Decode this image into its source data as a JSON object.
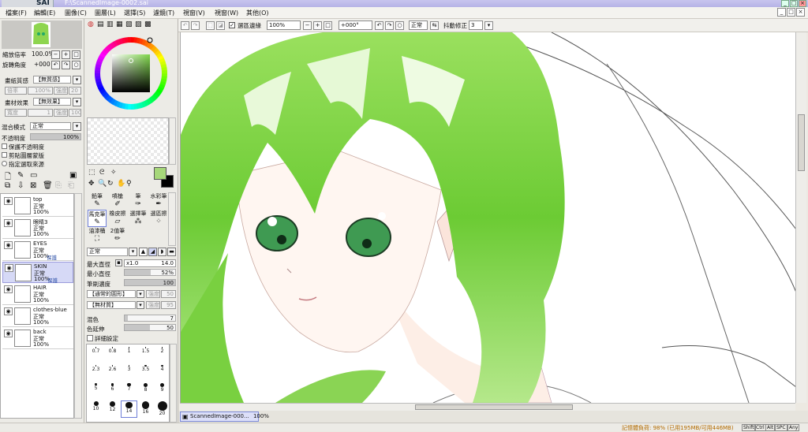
{
  "app": {
    "logo": "SAI",
    "title": "F:\\ScannedImage-0002.sai"
  },
  "window_buttons": [
    "_",
    "□",
    "×"
  ],
  "menu": [
    "檔案(F)",
    "編輯(E)",
    "圖像(C)",
    "圖層(L)",
    "選擇(S)",
    "濾鏡(T)",
    "視窗(V)",
    "視窗(W)",
    "其他(O)"
  ],
  "toolbar": {
    "selection_edge_label": "選區邊緣",
    "zoom_value": "100%",
    "rotation_value": "+000°",
    "blend_mode": "正常",
    "stabilizer_label": "抖動修正",
    "stabilizer_value": "3"
  },
  "navigator": {
    "zoom_label": "縮放倍率",
    "zoom_value": "100.0%",
    "rotate_label": "旋轉角度",
    "rotate_value": "+000"
  },
  "paper": {
    "texture_label": "畫紙質感",
    "texture_value": "【無質感】",
    "scale_label": "倍率",
    "scale_value": "100%",
    "strength_label": "強度",
    "strength_value": "20",
    "effect_label": "畫材效果",
    "effect_value": "【無效果】",
    "width_label": "寬度",
    "width_value": "1",
    "effect_strength_value": "100"
  },
  "layer_props": {
    "blend_label": "混合模式",
    "blend_value": "正常",
    "opacity_label": "不透明度",
    "opacity_value": "100%",
    "opacity_fraction": 1.0,
    "preserve_opacity": "保護不透明度",
    "clipping": "剪貼圖層蒙版",
    "selection_source": "指定選取來源"
  },
  "layers": [
    {
      "name": "top",
      "mode": "正常",
      "opacity": "100%",
      "protect": ""
    },
    {
      "name": "眼睛3",
      "mode": "正常",
      "opacity": "100%",
      "protect": ""
    },
    {
      "name": "EYES",
      "mode": "正常",
      "opacity": "100%",
      "protect": "保護"
    },
    {
      "name": "SKIN",
      "mode": "正常",
      "opacity": "100%",
      "protect": "保護"
    },
    {
      "name": "HAIR",
      "mode": "正常",
      "opacity": "100%",
      "protect": ""
    },
    {
      "name": "clothes-blue",
      "mode": "正常",
      "opacity": "100%",
      "protect": ""
    },
    {
      "name": "back",
      "mode": "正常",
      "opacity": "100%",
      "protect": ""
    }
  ],
  "tools_row1": [
    "鉛筆",
    "噴槍",
    "筆",
    "水彩筆"
  ],
  "tools_row2": [
    "馬克筆",
    "橡皮擦",
    "選擇筆",
    "選區擦"
  ],
  "tools_row3": [
    "油漆桶",
    "2值筆"
  ],
  "brush": {
    "mode_value": "正常",
    "max_size_label": "最大直徑",
    "max_size_mult": "x1.0",
    "max_size_value": "14.0",
    "min_size_label": "最小直徑",
    "min_size_value": "52%",
    "min_fraction": 0.52,
    "density_label": "筆刷濃度",
    "density_value": "100",
    "density_fraction": 1.0,
    "shape_value": "【通常的圓形】",
    "shape_strength_label": "強度",
    "shape_strength_value": "50",
    "texture_value": "【無材質】",
    "texture_strength_label": "強度",
    "texture_strength_value": "95",
    "blend_label": "混色",
    "blend_value": "7",
    "blend_fraction": 0.07,
    "persistence_label": "色延伸",
    "persistence_value": "50",
    "persistence_fraction": 0.5,
    "detail_label": "詳細設定"
  },
  "brush_sizes": [
    [
      "0.7",
      "0.8",
      "1",
      "1.5",
      "2"
    ],
    [
      "2.3",
      "2.6",
      "3",
      "3.5",
      "4"
    ],
    [
      "5",
      "6",
      "7",
      "8",
      "9"
    ],
    [
      "10",
      "12",
      "14",
      "16",
      "20"
    ]
  ],
  "selected_brush_size": "14",
  "colors": {
    "primary": "#a6d77a",
    "secondary": "#000000",
    "hair": "#7bd63d"
  },
  "document_tab": {
    "name": "ScannedImage-000...",
    "zoom": "100%"
  },
  "status": {
    "memory": "記憶體負荷: 98% (已用195MB/可用446MB)",
    "keys": [
      "Shift",
      "Ctrl",
      "Alt",
      "SPC",
      "Any"
    ]
  }
}
